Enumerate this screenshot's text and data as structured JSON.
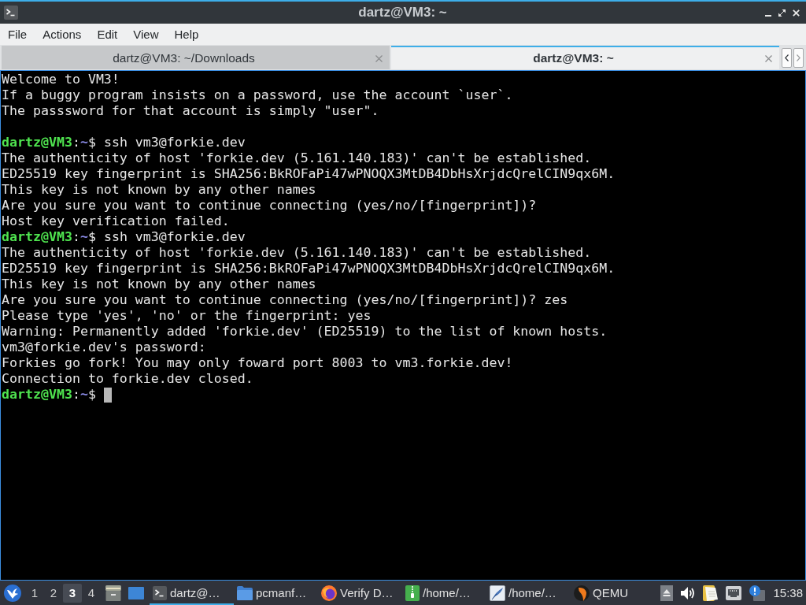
{
  "window": {
    "title": "dartz@VM3: ~"
  },
  "menu": [
    "File",
    "Actions",
    "Edit",
    "View",
    "Help"
  ],
  "tabs": [
    {
      "label": "dartz@VM3: ~/Downloads",
      "selected": false
    },
    {
      "label": "dartz@VM3: ~",
      "selected": true
    }
  ],
  "terminal": {
    "cursor": true,
    "lines": [
      {
        "kind": "output",
        "text": "Welcome to VM3!"
      },
      {
        "kind": "output",
        "text": "If a buggy program insists on a password, use the account `user`."
      },
      {
        "kind": "output",
        "text": "The passsword for that account is simply \"user\"."
      },
      {
        "kind": "blank"
      },
      {
        "kind": "prompt",
        "user": "dartz@VM3",
        "separator": ":",
        "path": "~",
        "symbol": "$",
        "command": "ssh vm3@forkie.dev"
      },
      {
        "kind": "output",
        "text": "The authenticity of host 'forkie.dev (5.161.140.183)' can't be established."
      },
      {
        "kind": "output",
        "text": "ED25519 key fingerprint is SHA256:BkROFaPi47wPNOQX3MtDB4DbHsXrjdcQrelCIN9qx6M."
      },
      {
        "kind": "output",
        "text": "This key is not known by any other names"
      },
      {
        "kind": "output",
        "text": "Are you sure you want to continue connecting (yes/no/[fingerprint])?"
      },
      {
        "kind": "output",
        "text": "Host key verification failed."
      },
      {
        "kind": "prompt",
        "user": "dartz@VM3",
        "separator": ":",
        "path": "~",
        "symbol": "$",
        "command": "ssh vm3@forkie.dev"
      },
      {
        "kind": "output",
        "text": "The authenticity of host 'forkie.dev (5.161.140.183)' can't be established."
      },
      {
        "kind": "output",
        "text": "ED25519 key fingerprint is SHA256:BkROFaPi47wPNOQX3MtDB4DbHsXrjdcQrelCIN9qx6M."
      },
      {
        "kind": "output",
        "text": "This key is not known by any other names"
      },
      {
        "kind": "output",
        "text": "Are you sure you want to continue connecting (yes/no/[fingerprint])? zes"
      },
      {
        "kind": "output",
        "text": "Please type 'yes', 'no' or the fingerprint: yes"
      },
      {
        "kind": "output",
        "text": "Warning: Permanently added 'forkie.dev' (ED25519) to the list of known hosts."
      },
      {
        "kind": "output",
        "text": "vm3@forkie.dev's password:"
      },
      {
        "kind": "output",
        "text": "Forkies go fork! You may only foward port 8003 to vm3.forkie.dev!"
      },
      {
        "kind": "output",
        "text": "Connection to forkie.dev closed."
      },
      {
        "kind": "prompt",
        "user": "dartz@VM3",
        "separator": ":",
        "path": "~",
        "symbol": "$"
      }
    ]
  },
  "taskbar": {
    "desktops": [
      {
        "label": "1",
        "selected": false
      },
      {
        "label": "2",
        "selected": false
      },
      {
        "label": "3",
        "selected": true
      },
      {
        "label": "4",
        "selected": false
      }
    ],
    "tasks": [
      {
        "kind": "terminal",
        "label": "dartz@…",
        "selected": true
      },
      {
        "kind": "folder",
        "label": "pcmanf…",
        "selected": false
      },
      {
        "kind": "browser",
        "label": "Verify D…",
        "selected": false
      },
      {
        "kind": "archive",
        "label": "/home/…",
        "selected": false
      },
      {
        "kind": "editor",
        "label": "/home/…",
        "selected": false
      },
      {
        "kind": "emulator",
        "label": "QEMU",
        "selected": false
      }
    ],
    "clock": "15:38"
  }
}
